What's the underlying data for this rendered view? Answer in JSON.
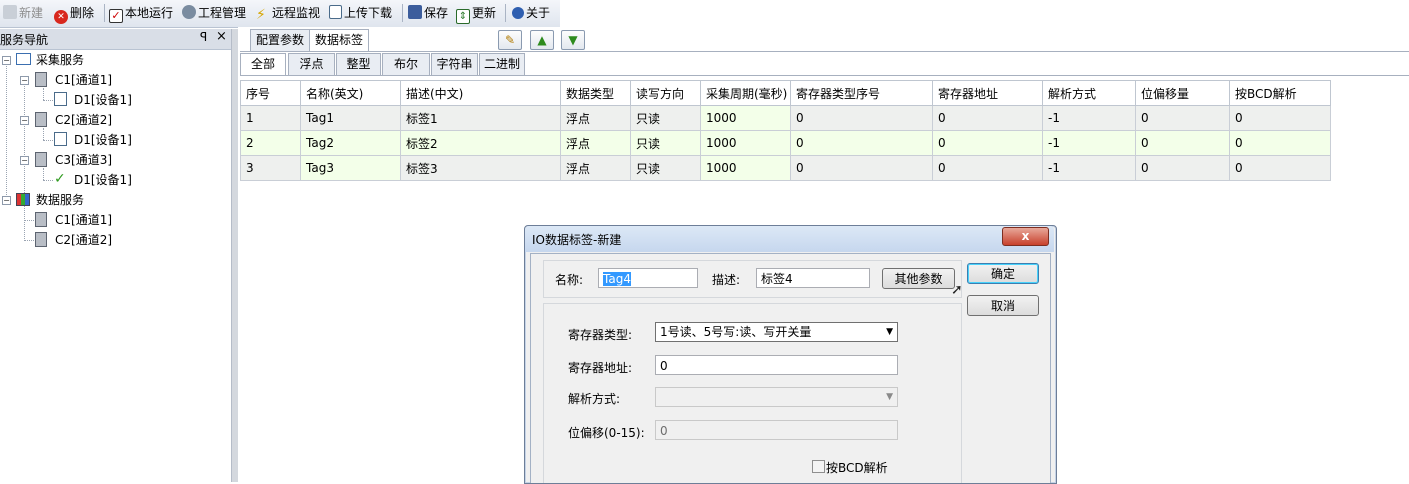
{
  "toolbar": {
    "new_label": "新建",
    "delete_label": "删除",
    "run_local_label": "本地运行",
    "project_mgmt_label": "工程管理",
    "remote_monitor_label": "远程监视",
    "upload_download_label": "上传下载",
    "save_label": "保存",
    "update_label": "更新",
    "about_label": "关于"
  },
  "nav": {
    "title": "服务导航",
    "pin": "ᵖ",
    "close": "×",
    "tree": [
      {
        "label": "采集服务",
        "icon": "folder-icon"
      },
      {
        "label": "C1[通道1]",
        "icon": "channel-icon"
      },
      {
        "label": "D1[设备1]",
        "icon": "device-edit-icon"
      },
      {
        "label": "C2[通道2]",
        "icon": "channel-icon"
      },
      {
        "label": "D1[设备1]",
        "icon": "device-edit-icon"
      },
      {
        "label": "C3[通道3]",
        "icon": "channel-icon"
      },
      {
        "label": "D1[设备1]",
        "icon": "check-icon"
      },
      {
        "label": "数据服务",
        "icon": "data-grid-icon"
      },
      {
        "label": "C1[通道1]",
        "icon": "channel-icon"
      },
      {
        "label": "C2[通道2]",
        "icon": "channel-icon"
      }
    ]
  },
  "tabs": {
    "config_label": "配置参数",
    "data_tags_label": "数据标签"
  },
  "subtabs": [
    "全部",
    "浮点",
    "整型",
    "布尔",
    "字符串",
    "二进制"
  ],
  "grid": {
    "headers": [
      "序号",
      "名称(英文)",
      "描述(中文)",
      "数据类型",
      "读写方向",
      "采集周期(毫秒)",
      "寄存器类型序号",
      "寄存器地址",
      "解析方式",
      "位偏移量",
      "按BCD解析"
    ],
    "rows": [
      [
        "1",
        "Tag1",
        "标签1",
        "浮点",
        "只读",
        "1000",
        "0",
        "0",
        "-1",
        "0",
        "0"
      ],
      [
        "2",
        "Tag2",
        "标签2",
        "浮点",
        "只读",
        "1000",
        "0",
        "0",
        "-1",
        "0",
        "0"
      ],
      [
        "3",
        "Tag3",
        "标签3",
        "浮点",
        "只读",
        "1000",
        "0",
        "0",
        "-1",
        "0",
        "0"
      ]
    ]
  },
  "dialog": {
    "title": "IO数据标签-新建",
    "close_glyph": "x",
    "name_label": "名称:",
    "name_value": "Tag4",
    "desc_label": "描述:",
    "desc_value": "标签4",
    "other_params_label": "其他参数",
    "ok_label": "确定",
    "cancel_label": "取消",
    "register_type_label": "寄存器类型:",
    "register_type_value": "1号读、5号写:读、写开关量",
    "register_addr_label": "寄存器地址:",
    "register_addr_value": "0",
    "parse_mode_label": "解析方式:",
    "parse_mode_value": "",
    "bit_offset_label": "位偏移(0-15):",
    "bit_offset_value": "0",
    "bcd_label": "按BCD解析"
  }
}
